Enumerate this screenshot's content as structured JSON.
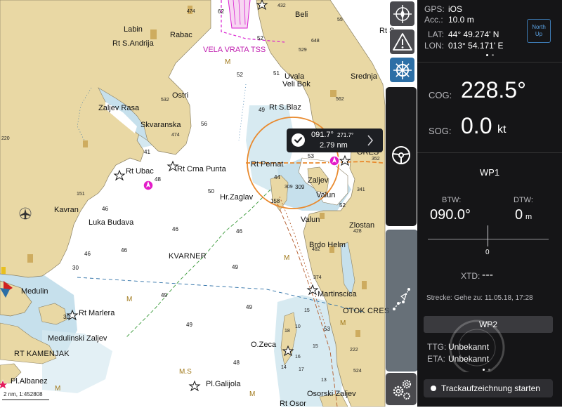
{
  "map": {
    "places": [
      {
        "name": "place-labin",
        "text": "Labin"
      },
      {
        "name": "place-rabac",
        "text": "Rabac"
      },
      {
        "name": "place-rt-s-andrija",
        "text": "Rt S.Andrija"
      },
      {
        "name": "place-ostri",
        "text": "Ostri"
      },
      {
        "name": "place-zaljev-rasa",
        "text": "Zaljev Rasa"
      },
      {
        "name": "place-skvaranska",
        "text": "Skvaranska"
      },
      {
        "name": "place-rt-ubac",
        "text": "Rt Ubac"
      },
      {
        "name": "place-rt-crna-punta",
        "text": "Rt Crna Punta"
      },
      {
        "name": "place-kavran",
        "text": "Kavran"
      },
      {
        "name": "place-luka-budava",
        "text": "Luka Budava"
      },
      {
        "name": "place-medulin",
        "text": "Medulin"
      },
      {
        "name": "place-rt-marlera",
        "text": "Rt Marlera"
      },
      {
        "name": "place-medulinski-zaljev",
        "text": "Medulinski Zaljev"
      },
      {
        "name": "place-pl-albanez",
        "text": "Pl.Albanez"
      },
      {
        "name": "place-pl-galijola",
        "text": "Pl.Galijola"
      },
      {
        "name": "place-o-zeca",
        "text": "O.Zeca"
      },
      {
        "name": "place-hr-zaglav",
        "text": "Hr.Zaglav"
      },
      {
        "name": "place-uvala",
        "text": "Uvala"
      },
      {
        "name": "place-veli-bok",
        "text": "Veli Bok"
      },
      {
        "name": "place-rt-s-blaz",
        "text": "Rt S.Blaz"
      },
      {
        "name": "place-rt-pernat",
        "text": "Rt Pernat"
      },
      {
        "name": "place-zaljev",
        "text": "Zaljev"
      },
      {
        "name": "place-valun-inner",
        "text": "Valun"
      },
      {
        "name": "place-valun",
        "text": "Valun"
      },
      {
        "name": "place-zlostan",
        "text": "Zlostan"
      },
      {
        "name": "place-brdo-helm",
        "text": "Brdo Helm"
      },
      {
        "name": "place-martinscica",
        "text": "Martinscica"
      },
      {
        "name": "place-osorski-zaljev",
        "text": "Osorski Zaljev"
      },
      {
        "name": "place-rt-osor",
        "text": "Rt Osor"
      },
      {
        "name": "place-beli",
        "text": "Beli"
      },
      {
        "name": "place-srednja",
        "text": "Srednja"
      },
      {
        "name": "place-rt-s",
        "text": "Rt S"
      },
      {
        "name": "place-ores",
        "text": "ORES"
      }
    ],
    "big_labels": [
      {
        "name": "label-kvarner",
        "text": "KVARNER"
      },
      {
        "name": "label-otok-cres",
        "text": "OTOK CRES"
      },
      {
        "name": "label-rt-kamenjak",
        "text": "RT KAMENJAK"
      }
    ],
    "tss_label": "VELA VRATA TSS",
    "depths": [
      "62",
      "52",
      "51",
      "49",
      "48",
      "56",
      "50",
      "46",
      "41",
      "46",
      "46",
      "46",
      "30",
      "49",
      "49",
      "49",
      "49",
      "48",
      "46",
      "52",
      "53",
      "44",
      "158",
      "309",
      "52",
      "15",
      "10",
      "18",
      "17",
      "13",
      "15",
      "14",
      "16",
      "53",
      "31"
    ],
    "heights": [
      "474",
      "432",
      "648",
      "529",
      "549",
      "562",
      "532",
      "474",
      "220",
      "151",
      "352",
      "341",
      "428",
      "482",
      "374",
      "222",
      "524",
      "51",
      "55",
      "309"
    ],
    "m_marks": [
      "M",
      "M",
      "M",
      "M",
      "M",
      "M",
      "M.S"
    ],
    "scale_text": "2 nm, 1:452808"
  },
  "popup": {
    "bearing": "091.7°",
    "bearing_magnetic": "271.7°",
    "distance": "2.79 nm"
  },
  "panel": {
    "gps_label": "GPS:",
    "gps_value": "iOS",
    "acc_label": "Acc.:",
    "acc_value": "10.0 m",
    "lat_label": "LAT:",
    "lat_value": "44° 49.274' N",
    "lon_label": "LON:",
    "lon_value": "013° 54.171' E",
    "north_up_line1": "North",
    "north_up_line2": "Up",
    "cog_label": "COG:",
    "cog_value": "228.5°",
    "sog_label": "SOG:",
    "sog_value": "0.0",
    "sog_unit": "kt",
    "waypoint1": "WP1",
    "btw_label": "BTW:",
    "btw_value": "090.0°",
    "dtw_label": "DTW:",
    "dtw_value": "0",
    "dtw_unit": "m",
    "xte_zero": "0",
    "xtd_label": "XTD:",
    "xtd_value": "---",
    "route_text": "Strecke: Gehe zu: 11.05.18, 17:28",
    "waypoint2": "WP2",
    "ttg_label": "TTG:",
    "ttg_value": "Unbekannt",
    "eta_label": "ETA:",
    "eta_value": "Unbekannt",
    "track_button": "Trackaufzeichnung starten"
  },
  "icons": [
    "crosshair-compass-icon",
    "warning-icon",
    "ship-wheel-icon",
    "steering-wheel-icon",
    "route-waypoints-icon",
    "settings-gears-icon",
    "checkmark-icon",
    "chevron-right-icon",
    "airport-icon",
    "anchor-icon",
    "pin-icon"
  ],
  "colors": {
    "land": "#e9d8a4",
    "shallow": "#c6e0ec",
    "water": "#ffffff",
    "panel": "#151517",
    "tool_active": "#2c6fa6",
    "route": "#e98a2e",
    "tss": "#d91ed0"
  }
}
